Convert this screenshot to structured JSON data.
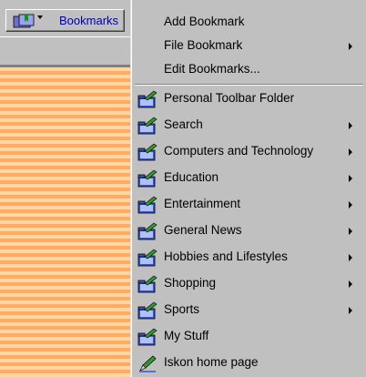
{
  "toolbar": {
    "bookmarks_label": "Bookmarks"
  },
  "menu": {
    "top_items": [
      {
        "label": "Add Bookmark",
        "submenu": false
      },
      {
        "label": "File Bookmark",
        "submenu": true
      },
      {
        "label": "Edit Bookmarks...",
        "submenu": false
      }
    ],
    "folders": [
      {
        "label": "Personal Toolbar Folder",
        "submenu": false,
        "icon": "folder-icon"
      },
      {
        "label": "Search",
        "submenu": true,
        "icon": "folder-icon"
      },
      {
        "label": "Computers and Technology",
        "submenu": true,
        "icon": "folder-icon"
      },
      {
        "label": "Education",
        "submenu": true,
        "icon": "folder-icon"
      },
      {
        "label": "Entertainment",
        "submenu": true,
        "icon": "folder-icon"
      },
      {
        "label": "General News",
        "submenu": true,
        "icon": "folder-icon"
      },
      {
        "label": "Hobbies and Lifestyles",
        "submenu": true,
        "icon": "folder-icon"
      },
      {
        "label": "Shopping",
        "submenu": true,
        "icon": "folder-icon"
      },
      {
        "label": "Sports",
        "submenu": true,
        "icon": "folder-icon"
      },
      {
        "label": "My Stuff",
        "submenu": false,
        "icon": "folder-icon"
      },
      {
        "label": "Iskon home page",
        "submenu": false,
        "icon": "bookmark-pen-icon"
      }
    ]
  },
  "colors": {
    "menu_bg": "#c0c0c0",
    "link_blue": "#0000a8",
    "stripe_light": "#ffd5a0",
    "stripe_dark": "#ffaa66",
    "folder_blue": "#3a55c8",
    "folder_green": "#2f9a2f"
  }
}
